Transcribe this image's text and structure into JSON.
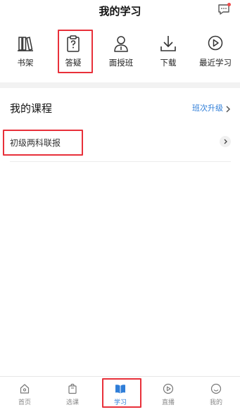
{
  "header": {
    "title": "我的学习"
  },
  "quick_nav": [
    {
      "label": "书架",
      "icon": "bookshelf-icon"
    },
    {
      "label": "答疑",
      "icon": "clipboard-question-icon"
    },
    {
      "label": "面授班",
      "icon": "teacher-icon"
    },
    {
      "label": "下载",
      "icon": "download-icon"
    },
    {
      "label": "最近学习",
      "icon": "play-circle-icon"
    }
  ],
  "courses": {
    "title": "我的课程",
    "upgrade_label": "班次升级",
    "items": [
      {
        "label": "初级两科联报"
      }
    ]
  },
  "tabbar": [
    {
      "label": "首页",
      "icon": "home-icon",
      "active": false
    },
    {
      "label": "选课",
      "icon": "shopping-bag-icon",
      "active": false
    },
    {
      "label": "学习",
      "icon": "open-book-icon",
      "active": true
    },
    {
      "label": "直播",
      "icon": "live-play-icon",
      "active": false
    },
    {
      "label": "我的",
      "icon": "profile-face-icon",
      "active": false
    }
  ],
  "colors": {
    "accent": "#2f7ed8",
    "highlight": "#e8303a",
    "notification_dot": "#f04a4a"
  }
}
